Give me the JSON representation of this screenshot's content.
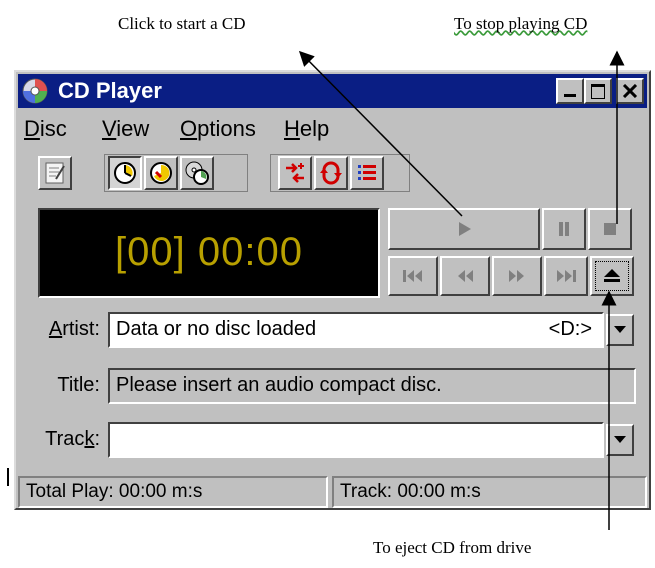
{
  "annotations": {
    "start_cd": "Click to start a CD",
    "stop_cd": "To stop playing CD",
    "eject_cd": "To eject CD from drive"
  },
  "window": {
    "title": "CD Player",
    "title_icon": "cd-disc-icon"
  },
  "titlebar_buttons": [
    "minimize-icon",
    "maximize-icon",
    "close-icon"
  ],
  "menu": [
    {
      "label": "Disc",
      "mnemonic": "D"
    },
    {
      "label": "View",
      "mnemonic": "V"
    },
    {
      "label": "Options",
      "mnemonic": "O"
    },
    {
      "label": "Help",
      "mnemonic": "H"
    }
  ],
  "toolbar": [
    "edit-playlist-icon",
    "track-time-elapsed-icon",
    "track-time-remaining-icon",
    "disc-time-remaining-icon",
    "random-order-icon",
    "continuous-play-icon",
    "intro-play-icon"
  ],
  "display": {
    "readout": "[00] 00:00",
    "color": "#b8a000"
  },
  "controls": [
    "play-icon",
    "pause-icon",
    "stop-icon",
    "previous-track-icon",
    "skip-backwards-icon",
    "skip-forwards-icon",
    "next-track-icon",
    "eject-icon"
  ],
  "fields": {
    "artist": {
      "label_pre": "",
      "label_mn": "A",
      "label_post": "rtist:",
      "value": "Data or no disc loaded",
      "drive": "<D:>"
    },
    "title": {
      "label": "Title:",
      "value": "Please insert an audio compact disc."
    },
    "track": {
      "label_pre": "Trac",
      "label_mn": "k",
      "label_post": ":",
      "value": ""
    }
  },
  "status": {
    "total_play": "Total Play: 00:00 m:s",
    "track": "Track: 00:00 m:s"
  }
}
